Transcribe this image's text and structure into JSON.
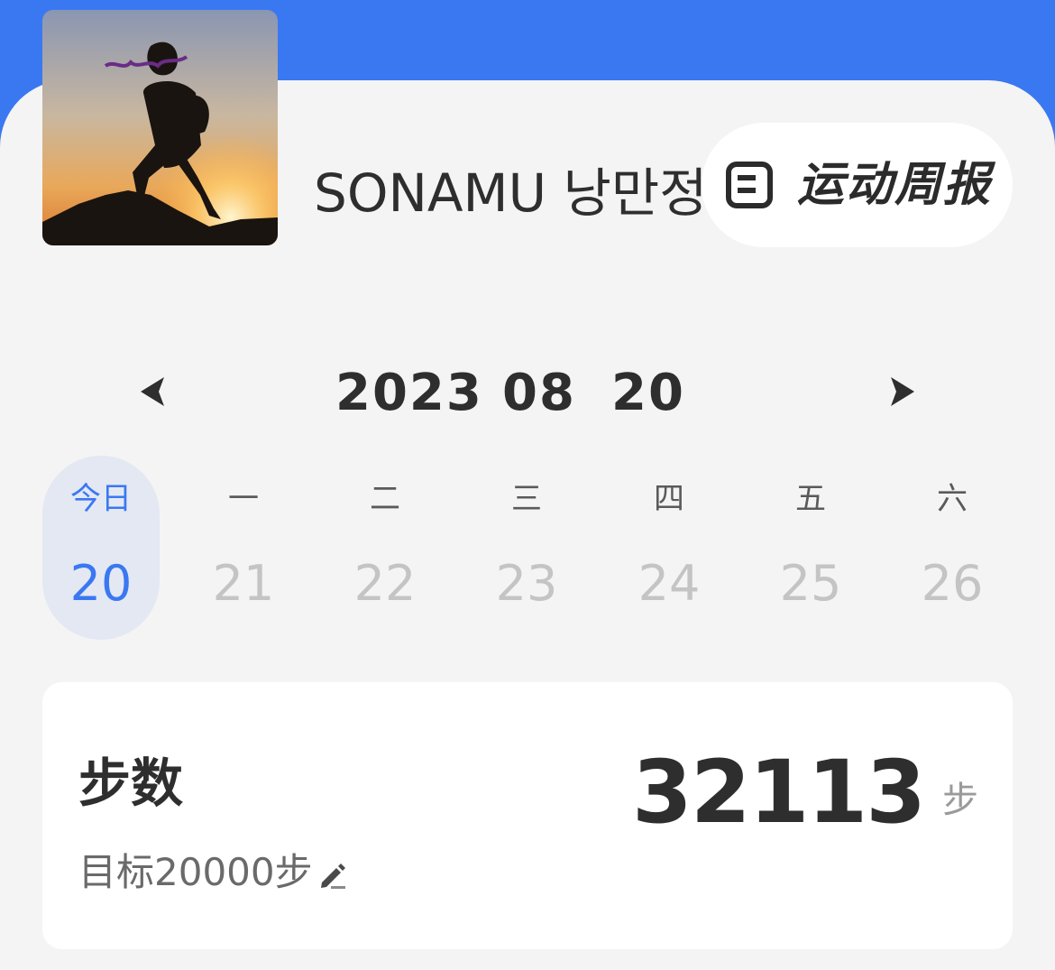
{
  "header": {
    "username": "SONAMU 낭만정",
    "weekly_report_label": "运动周报"
  },
  "date_nav": {
    "year": "2023",
    "month": "08",
    "day": "20"
  },
  "week": [
    {
      "weekday": "今日",
      "date": "20",
      "active": true
    },
    {
      "weekday": "一",
      "date": "21",
      "active": false
    },
    {
      "weekday": "二",
      "date": "22",
      "active": false
    },
    {
      "weekday": "三",
      "date": "23",
      "active": false
    },
    {
      "weekday": "四",
      "date": "24",
      "active": false
    },
    {
      "weekday": "五",
      "date": "25",
      "active": false
    },
    {
      "weekday": "六",
      "date": "26",
      "active": false
    }
  ],
  "steps_card": {
    "title": "步数",
    "goal": "目标20000步",
    "value": "32113",
    "unit": "步"
  },
  "colors": {
    "accent": "#3a78f2",
    "background": "#f4f4f4",
    "active_day_bg": "#e3e8f3"
  },
  "icons": {
    "weekly_report": "report-icon",
    "prev": "triangle-left-icon",
    "next": "triangle-right-icon",
    "edit": "pencil-icon"
  }
}
